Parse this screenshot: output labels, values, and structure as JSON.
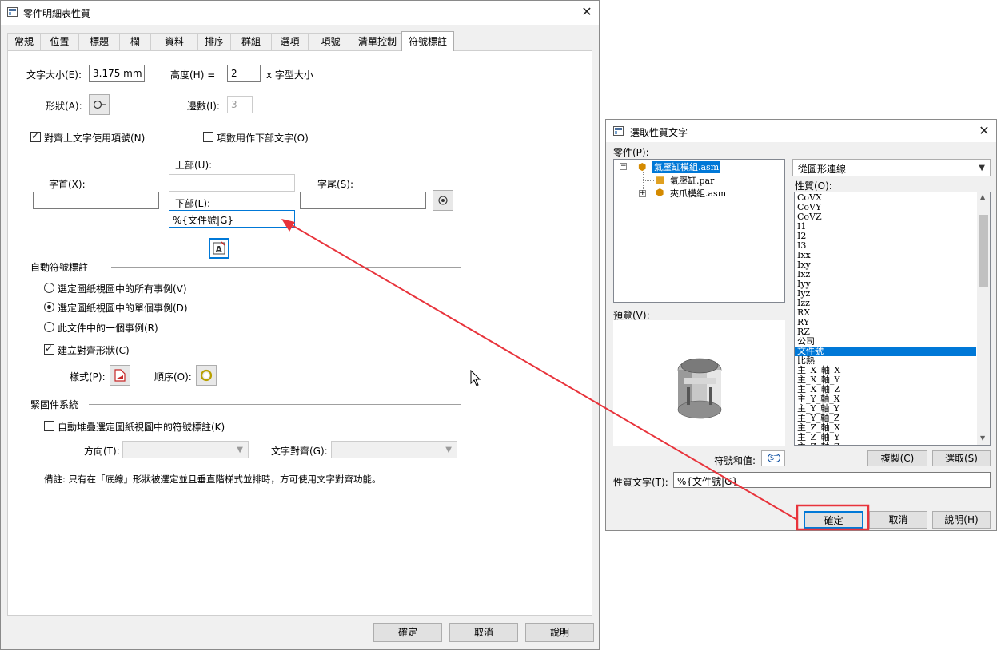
{
  "main": {
    "title": "零件明細表性質",
    "tabs": [
      "常規",
      "位置",
      "標題",
      "欄",
      "資料",
      "排序",
      "群組",
      "選項",
      "項號",
      "清單控制",
      "符號標註"
    ],
    "active_tab": "符號標註",
    "text_size_label": "文字大小(E):",
    "text_size_value": "3.175 mm",
    "height_label": "高度(H) =",
    "height_value": "2",
    "height_suffix": "x 字型大小",
    "shape_label": "形狀(A):",
    "sides_label": "邊數(I):",
    "sides_value": "3",
    "align_top_text": "對齊上文字使用項號(N)",
    "use_count_bottom": "項數用作下部文字(O)",
    "top_label": "上部(U):",
    "prefix_label": "字首(X):",
    "bottom_label": "下部(L):",
    "bottom_value": "%{文件號|G}",
    "suffix_label": "字尾(S):",
    "auto_balloon_header": "自動符號標註",
    "radio_all": "選定圖紙視圖中的所有事例(V)",
    "radio_single": "選定圖紙視圖中的單個事例(D)",
    "radio_one_doc": "此文件中的一個事例(R)",
    "create_align_shape": "建立對齊形狀(C)",
    "style_label": "樣式(P):",
    "order_label": "順序(O):",
    "fastener_header": "緊固件系統",
    "auto_stack": "自動堆疊選定圖紙視圖中的符號標註(K)",
    "direction_label": "方向(T):",
    "text_align_label": "文字對齊(G):",
    "note": "備註: 只有在「底線」形狀被選定並且垂直階梯式並排時，方可使用文字對齊功能。",
    "ok": "確定",
    "cancel": "取消",
    "help": "說明"
  },
  "sub": {
    "title": "選取性質文字",
    "parts_label": "零件(P):",
    "tree": [
      "氣壓缸模組.asm",
      "氣壓缸.par",
      "夾爪模組.asm"
    ],
    "source_value": "從圖形連線",
    "properties_label": "性質(O):",
    "properties": [
      "CoVX",
      "CoVY",
      "CoVZ",
      "I1",
      "I2",
      "I3",
      "Ixx",
      "Ixy",
      "Ixz",
      "Iyy",
      "Iyz",
      "Izz",
      "RX",
      "RY",
      "RZ",
      "公司",
      "文件號",
      "比熱",
      "主_X_軸_X",
      "主_X_軸_Y",
      "主_X_軸_Z",
      "主_Y_軸_X",
      "主_Y_軸_Y",
      "主_Y_軸_Z",
      "主_Z_軸_X",
      "主_Z_軸_Y",
      "主_Z_軸_Z"
    ],
    "selected_property": "文件號",
    "preview_label": "預覽(V):",
    "symbol_value_label": "符號和值:",
    "symbol_button": "ST",
    "copy": "複製(C)",
    "select": "選取(S)",
    "prop_text_label": "性質文字(T):",
    "prop_text_value": "%{文件號|G}",
    "ok": "確定",
    "cancel": "取消",
    "help": "說明(H)"
  },
  "colors": {
    "highlight": "#e8333b",
    "selection": "#0078d7",
    "dialog_bg": "#f0f0f0"
  }
}
